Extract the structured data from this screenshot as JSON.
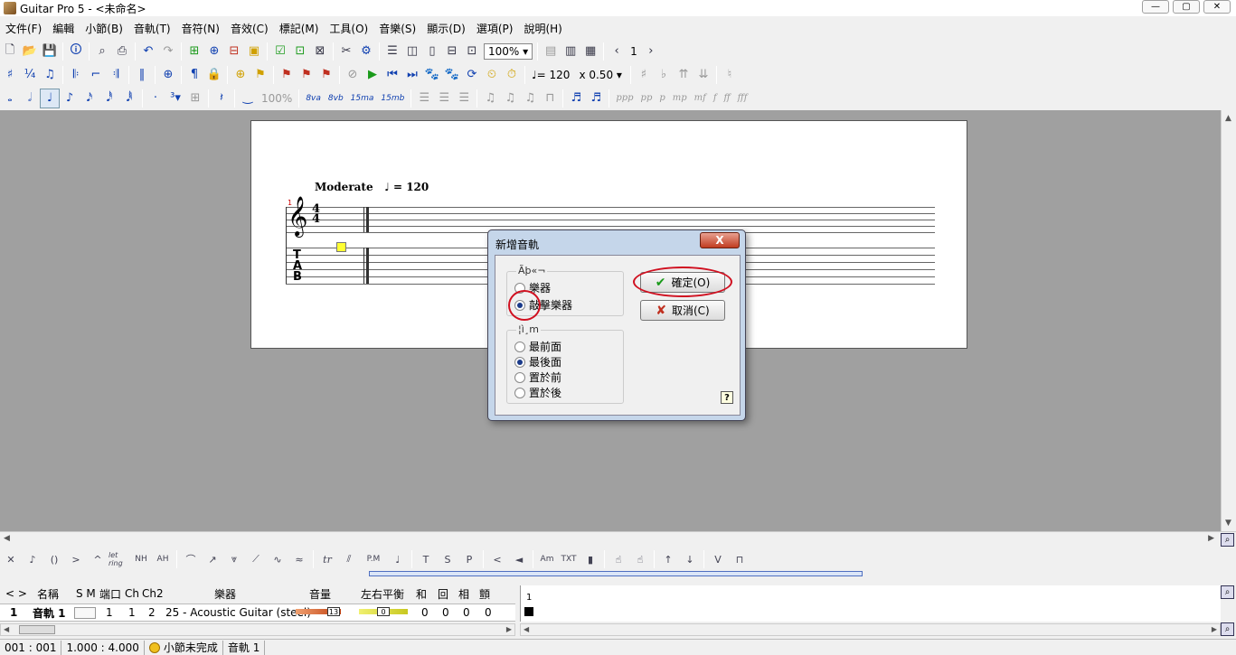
{
  "window": {
    "title": "Guitar Pro 5 - <未命名>",
    "min_label": "—",
    "max_label": "▢",
    "close_label": "✕"
  },
  "menu": [
    "文件(F)",
    "編輯",
    "小節(B)",
    "音軌(T)",
    "音符(N)",
    "音效(C)",
    "標記(M)",
    "工具(O)",
    "音樂(S)",
    "顯示(D)",
    "選項(P)",
    "說明(H)"
  ],
  "toolbar": {
    "zoom": "100%",
    "page_number": "1",
    "tempo": "♩= 120",
    "speed": "x 0.50",
    "velocity_value": "100%",
    "octave_8va": "8va",
    "octave_8vb": "8vb",
    "octave_15ma": "15ma",
    "octave_15mb": "15mb",
    "dyn": [
      "ppp",
      "pp",
      "p",
      "mp",
      "mf",
      "f",
      "ff",
      "fff"
    ]
  },
  "score": {
    "tempo_label": "Moderate",
    "tempo_value": "♩ = 120",
    "measure_number": "1",
    "clef": "𝄞",
    "time_top": "4",
    "time_bottom": "4",
    "tab_label": [
      "T",
      "A",
      "B"
    ]
  },
  "dialog": {
    "title": "新增音軌",
    "close_label": "X",
    "group1_label": "Ãþ«¬",
    "radio_instrument": "樂器",
    "radio_drum": "敲擊樂器",
    "group2_label": "¦ì¸m",
    "pos_first": "最前面",
    "pos_last": "最後面",
    "pos_before": "置於前",
    "pos_after": "置於後",
    "ok_label": "確定(O)",
    "cancel_label": "取消(C)",
    "help_label": "?"
  },
  "effects": {
    "pm": "P.M",
    "t": "T",
    "s": "S",
    "p": "P",
    "txt": "TXT",
    "am": "Am",
    "tr": "tr",
    "nh": "NH",
    "ah": "AH",
    "v": "V"
  },
  "tracks": {
    "headers": {
      "nav": "< >",
      "name": "名稱",
      "sm": "S M",
      "port": "端口",
      "ch": "Ch",
      "ch2": "Ch2",
      "instrument": "樂器",
      "volume": "音量",
      "pan": "左右平衡",
      "chorus": "和",
      "reverb": "回",
      "phaser": "相",
      "tremolo": "顫"
    },
    "rows": [
      {
        "num": "1",
        "name": "音軌 1",
        "port": "1",
        "ch": "1",
        "ch2": "2",
        "instrument": "25 - Acoustic Guitar (steel)",
        "volume": "13",
        "pan": "0",
        "chorus": "0",
        "reverb": "0",
        "phaser": "0",
        "tremolo": "0"
      }
    ],
    "measure_ruler": "1"
  },
  "status": {
    "position": "001 : 001",
    "time": "1.000 : 4.000",
    "warning": "小節未完成",
    "track": "音軌 1"
  },
  "colors": {
    "accent_ring": "#d01020",
    "dialog_frame": "#c5d6ea",
    "workspace": "#a0a0a0"
  }
}
